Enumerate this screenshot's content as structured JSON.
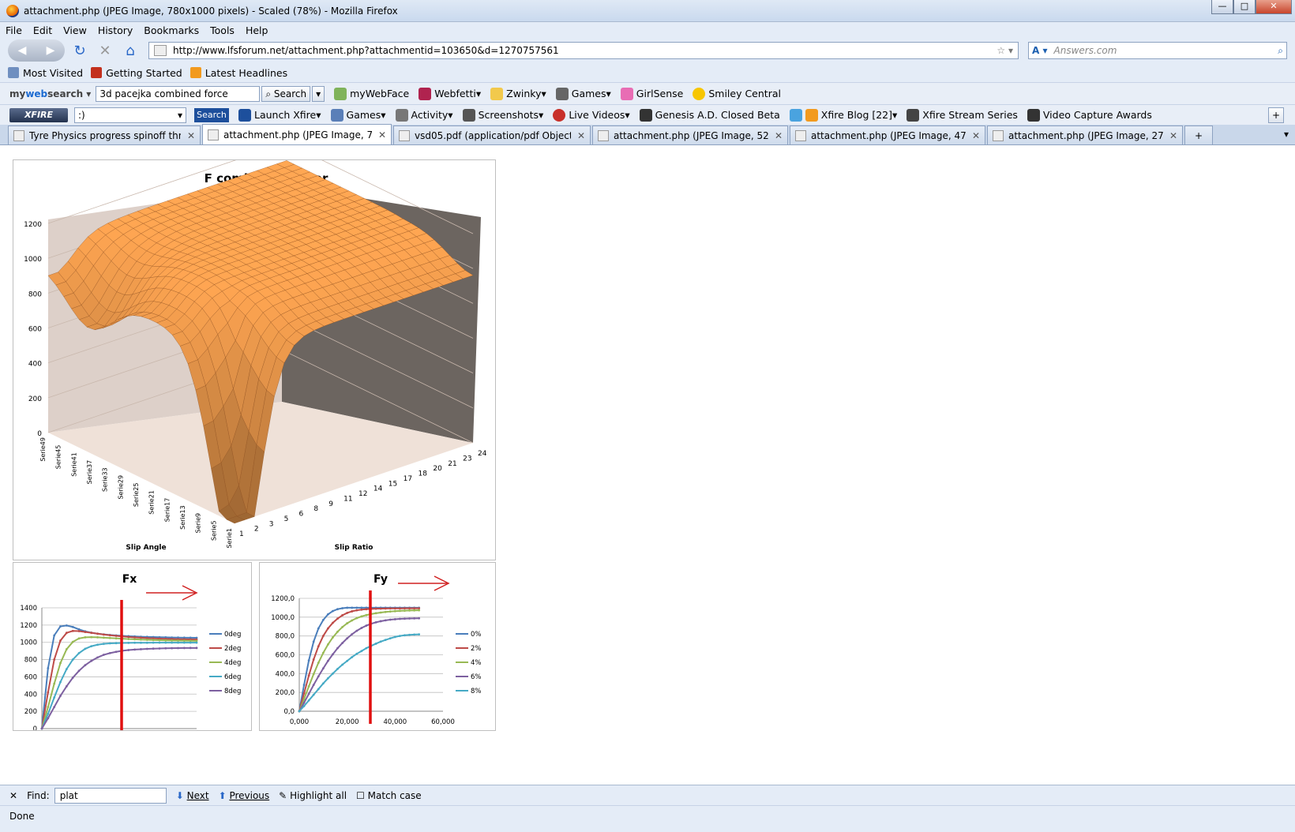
{
  "window": {
    "title": "attachment.php (JPEG Image, 780x1000 pixels) - Scaled (78%) - Mozilla Firefox"
  },
  "menu": [
    "File",
    "Edit",
    "View",
    "History",
    "Bookmarks",
    "Tools",
    "Help"
  ],
  "nav": {
    "url": "http://www.lfsforum.net/attachment.php?attachmentid=103650&d=1270757561",
    "search_placeholder": "Answers.com"
  },
  "bookmarks": [
    "Most Visited",
    "Getting Started",
    "Latest Headlines"
  ],
  "toolbar1": {
    "brand_a": "my",
    "brand_b": "web",
    "brand_c": "search",
    "query": "3d pacejka combined force",
    "search_label": "Search",
    "items": [
      "myWebFace",
      "Webfetti",
      "Zwinky",
      "Games",
      "GirlSense",
      "Smiley Central"
    ]
  },
  "toolbar2": {
    "xfire": "XFIRE",
    "select_value": ":)",
    "search_label": "Search",
    "items": [
      "Launch Xfire",
      "Games",
      "Activity",
      "Screenshots",
      "Live Videos",
      "Genesis A.D. Closed Beta",
      "Xfire Blog [22]",
      "Xfire Stream Series",
      "Video Capture Awards"
    ]
  },
  "tabs": [
    {
      "label": "Tyre Physics progress spinoff threa...",
      "active": false
    },
    {
      "label": "attachment.php (JPEG Image, 78...",
      "active": true
    },
    {
      "label": "vsd05.pdf (application/pdf Object)",
      "active": false
    },
    {
      "label": "attachment.php (JPEG Image, 524x4...",
      "active": false
    },
    {
      "label": "attachment.php (JPEG Image, 477x4...",
      "active": false
    },
    {
      "label": "attachment.php (JPEG Image, 277x1...",
      "active": false
    }
  ],
  "findbar": {
    "label": "Find:",
    "value": "plat",
    "next": "Next",
    "previous": "Previous",
    "highlight": "Highlight all",
    "match_case": "Match case"
  },
  "status": "Done",
  "chart_data": [
    {
      "type": "surface",
      "title": "F combined vector",
      "xlabel": "Slip Angle",
      "ylabel": "Slip Ratio",
      "zlim": [
        0,
        1200
      ],
      "z_ticks": [
        "0",
        "200",
        "400",
        "600",
        "800",
        "1000",
        "1200"
      ],
      "x_ticks": [
        "Serie1",
        "Serie5",
        "Serie9",
        "Serie13",
        "Serie17",
        "Serie21",
        "Serie25",
        "Serie29",
        "Serie33",
        "Serie37",
        "Serie41",
        "Serie45",
        "Serie49"
      ],
      "y_ticks": [
        "1",
        "2",
        "3",
        "5",
        "6",
        "8",
        "9",
        "11",
        "12",
        "14",
        "15",
        "17",
        "18",
        "20",
        "21",
        "23",
        "24"
      ],
      "colors": {
        "surface": "#e8964a",
        "back_wall": "#ddd0c9",
        "side_wall": "#6c6560"
      }
    },
    {
      "type": "line",
      "title": "Fx",
      "ylim": [
        0,
        1400
      ],
      "y_ticks": [
        "0",
        "200",
        "400",
        "600",
        "800",
        "1000",
        "1200",
        "1400"
      ],
      "x": [
        0,
        2,
        4,
        6,
        8,
        10,
        12,
        14,
        16,
        18,
        20,
        22,
        24,
        26,
        28,
        30,
        32,
        34,
        36,
        38,
        40,
        42,
        44,
        46,
        48,
        50
      ],
      "series": [
        {
          "name": "0deg",
          "color": "#4a7ebb",
          "values": [
            0,
            700,
            1080,
            1185,
            1195,
            1178,
            1150,
            1127,
            1112,
            1100,
            1092,
            1085,
            1080,
            1075,
            1071,
            1068,
            1065,
            1063,
            1061,
            1059,
            1058,
            1056,
            1055,
            1054,
            1053,
            1052
          ]
        },
        {
          "name": "2deg",
          "color": "#be4b48",
          "values": [
            0,
            420,
            800,
            1020,
            1110,
            1132,
            1130,
            1120,
            1110,
            1100,
            1090,
            1082,
            1075,
            1068,
            1062,
            1057,
            1053,
            1049,
            1046,
            1043,
            1040,
            1038,
            1036,
            1035,
            1034,
            1033
          ]
        },
        {
          "name": "4deg",
          "color": "#98b954",
          "values": [
            0,
            250,
            520,
            760,
            920,
            1005,
            1045,
            1058,
            1060,
            1058,
            1054,
            1050,
            1046,
            1042,
            1038,
            1035,
            1032,
            1029,
            1027,
            1025,
            1023,
            1021,
            1020,
            1019,
            1018,
            1017
          ]
        },
        {
          "name": "6deg",
          "color": "#46aac5",
          "values": [
            0,
            170,
            360,
            540,
            690,
            800,
            875,
            925,
            955,
            972,
            982,
            988,
            991,
            993,
            994,
            995,
            995,
            995,
            996,
            996,
            996,
            996,
            996,
            996,
            996,
            996
          ]
        },
        {
          "name": "8deg",
          "color": "#7d60a0",
          "values": [
            0,
            120,
            250,
            380,
            490,
            590,
            670,
            735,
            785,
            825,
            855,
            875,
            890,
            902,
            910,
            916,
            920,
            924,
            927,
            929,
            931,
            932,
            933,
            934,
            935,
            935
          ]
        }
      ]
    },
    {
      "type": "line",
      "title": "Fy",
      "xlim": [
        0,
        60
      ],
      "ylim": [
        0,
        1200
      ],
      "x_ticks": [
        "0,000",
        "20,000",
        "40,000",
        "60,000"
      ],
      "y_ticks": [
        "0,0",
        "200,0",
        "400,0",
        "600,0",
        "800,0",
        "1000,0",
        "1200,0"
      ],
      "x": [
        0,
        2,
        4,
        6,
        8,
        10,
        12,
        14,
        16,
        18,
        20,
        22,
        24,
        26,
        28,
        30,
        32,
        34,
        36,
        38,
        40,
        42,
        44,
        46,
        48,
        50
      ],
      "series": [
        {
          "name": "0%",
          "color": "#4a7ebb",
          "values": [
            0,
            280,
            540,
            740,
            880,
            970,
            1030,
            1065,
            1085,
            1095,
            1100,
            1100,
            1100,
            1100,
            1100,
            1100,
            1100,
            1100,
            1100,
            1100,
            1100,
            1100,
            1100,
            1100,
            1100,
            1100
          ]
        },
        {
          "name": "2%",
          "color": "#be4b48",
          "values": [
            0,
            190,
            380,
            550,
            690,
            800,
            880,
            940,
            985,
            1020,
            1045,
            1062,
            1073,
            1080,
            1085,
            1088,
            1090,
            1091,
            1092,
            1093,
            1093,
            1093,
            1094,
            1094,
            1094,
            1094
          ]
        },
        {
          "name": "4%",
          "color": "#98b954",
          "values": [
            0,
            130,
            265,
            395,
            515,
            620,
            710,
            785,
            845,
            895,
            935,
            965,
            990,
            1008,
            1022,
            1033,
            1042,
            1049,
            1055,
            1060,
            1064,
            1067,
            1069,
            1071,
            1072,
            1073
          ]
        },
        {
          "name": "6%",
          "color": "#7d60a0",
          "values": [
            0,
            90,
            185,
            280,
            370,
            455,
            535,
            605,
            670,
            725,
            775,
            818,
            855,
            885,
            910,
            930,
            945,
            957,
            966,
            973,
            978,
            982,
            984,
            986,
            987,
            988
          ]
        },
        {
          "name": "8%",
          "color": "#46aac5",
          "values": [
            0,
            55,
            115,
            175,
            235,
            295,
            350,
            400,
            450,
            495,
            535,
            575,
            610,
            640,
            670,
            695,
            718,
            740,
            758,
            775,
            790,
            800,
            808,
            812,
            815,
            817
          ]
        }
      ]
    }
  ]
}
